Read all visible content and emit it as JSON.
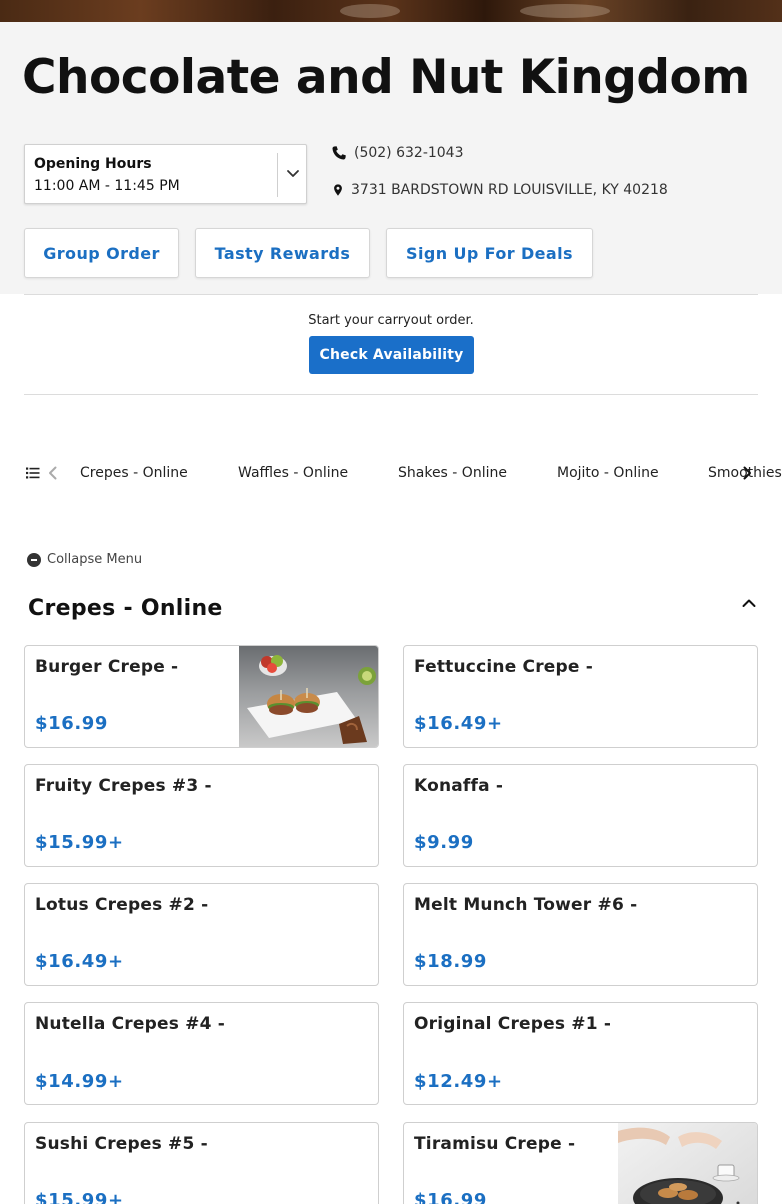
{
  "restaurant": {
    "name": "Chocolate and Nut Kingdom",
    "hours_label": "Opening Hours",
    "hours_value": "11:00 AM - 11:45 PM",
    "phone": "(502) 632-1043",
    "address": "3731 BARDSTOWN RD LOUISVILLE, KY 40218"
  },
  "actions": {
    "group_order": "Group Order",
    "tasty_rewards": "Tasty Rewards",
    "sign_up_deals": "Sign Up For Deals"
  },
  "carryout": {
    "prompt": "Start your carryout order.",
    "button": "Check Availability"
  },
  "categories": [
    "Crepes - Online",
    "Waffles - Online",
    "Shakes - Online",
    "Mojito - Online",
    "Smoothies"
  ],
  "menu": {
    "collapse_label": "Collapse Menu",
    "section_title": "Crepes - Online",
    "items": [
      {
        "name": "Burger Crepe -",
        "price": "$16.99",
        "has_image": true
      },
      {
        "name": "Fettuccine Crepe -",
        "price": "$16.49+",
        "has_image": false
      },
      {
        "name": "Fruity Crepes #3 -",
        "price": "$15.99+",
        "has_image": false
      },
      {
        "name": "Konaffa -",
        "price": "$9.99",
        "has_image": false
      },
      {
        "name": "Lotus Crepes #2 -",
        "price": "$16.49+",
        "has_image": false
      },
      {
        "name": "Melt Munch Tower #6 -",
        "price": "$18.99",
        "has_image": false
      },
      {
        "name": "Nutella Crepes #4 -",
        "price": "$14.99+",
        "has_image": false
      },
      {
        "name": "Original Crepes #1 -",
        "price": "$12.49+",
        "has_image": false
      },
      {
        "name": "Sushi Crepes #5 -",
        "price": "$15.99+",
        "has_image": false
      },
      {
        "name": "Tiramisu Crepe -",
        "price": "$16.99",
        "has_image": true
      }
    ]
  },
  "colors": {
    "accent": "#1b6fc2",
    "button_bg": "#1a6fc9",
    "header_bg": "#f4f4f4"
  },
  "icons": [
    "chevron-down-icon",
    "phone-icon",
    "location-pin-icon",
    "list-icon",
    "chevron-left-icon",
    "chevron-right-icon",
    "minus-circle-icon",
    "chevron-up-icon"
  ]
}
